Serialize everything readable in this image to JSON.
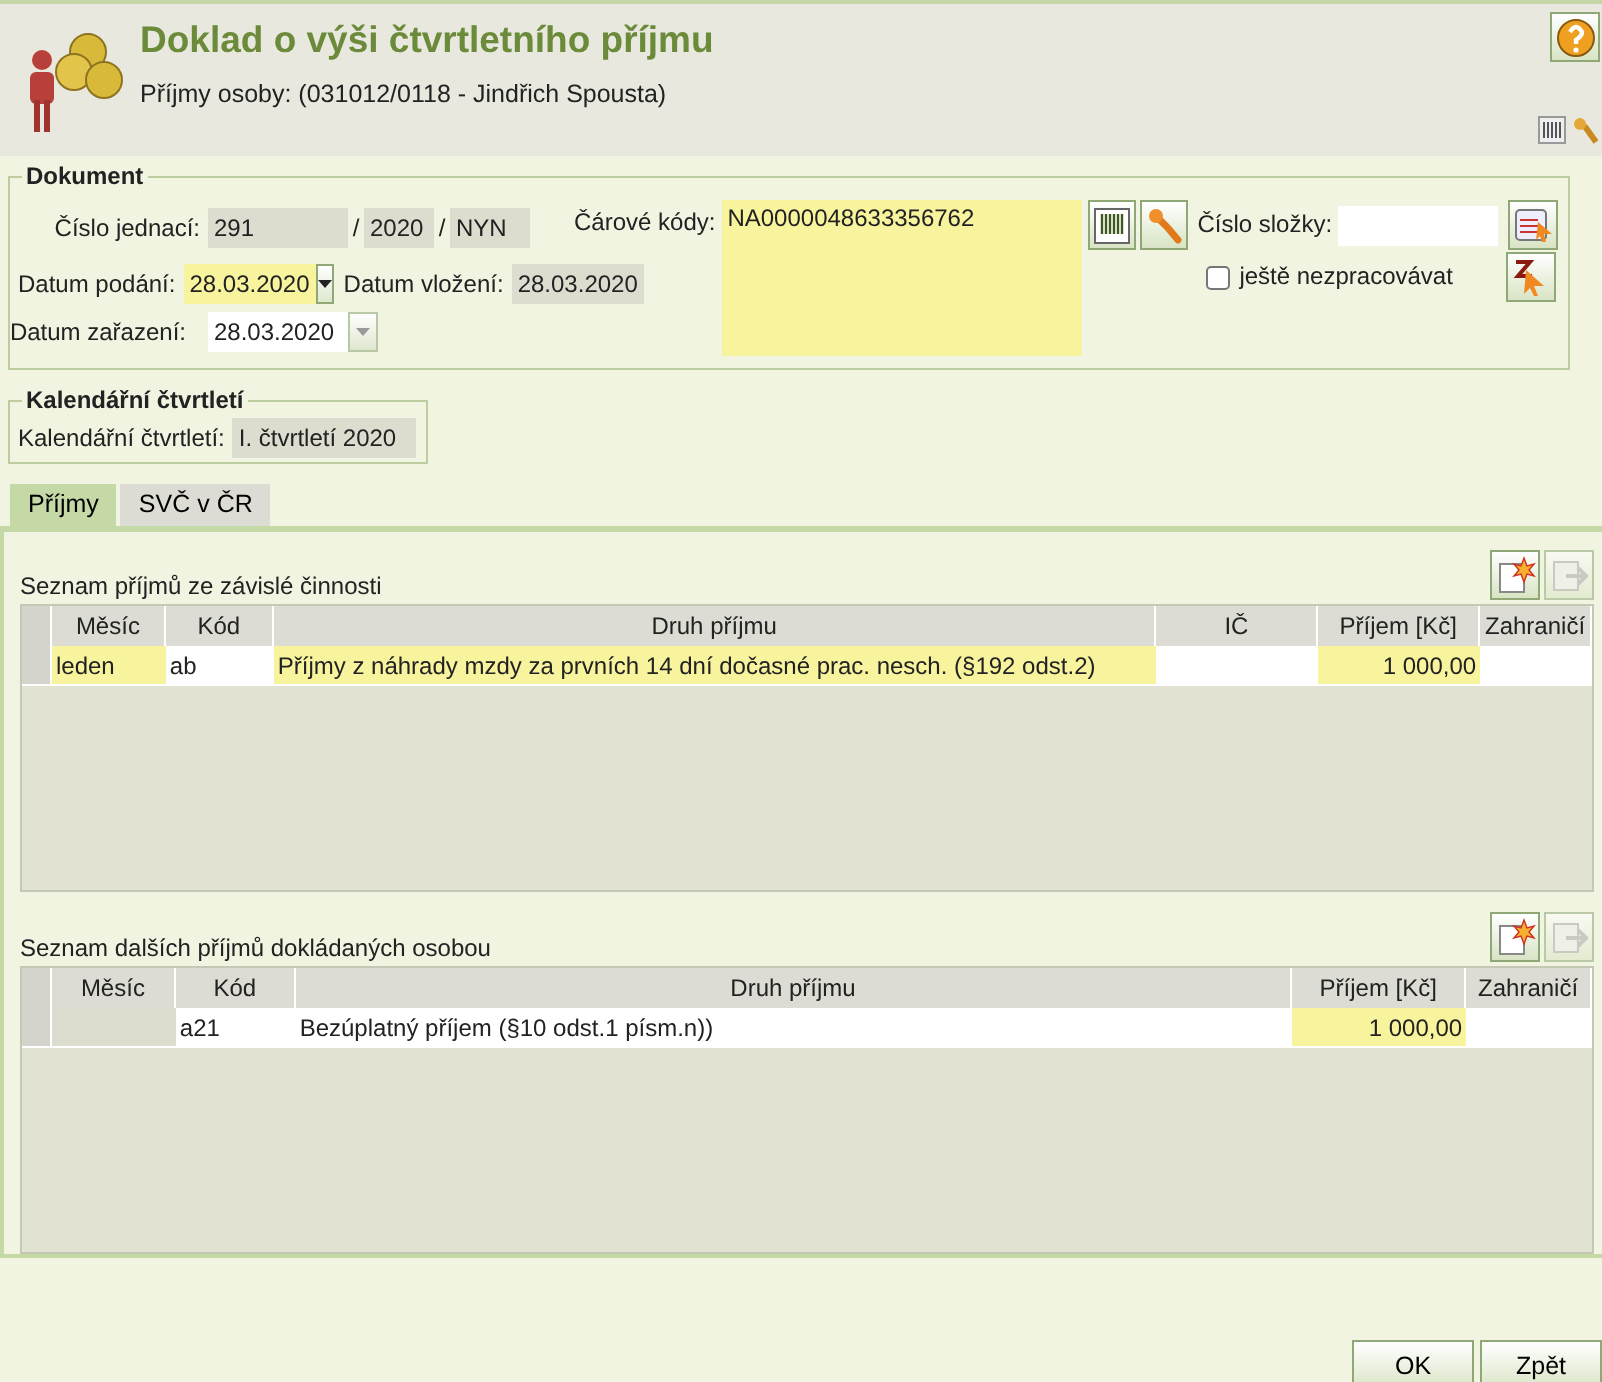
{
  "header": {
    "title": "Doklad o výši čtvrtletního příjmu",
    "subtitle": "Příjmy osoby: (031012/0118 - Jindřich Spousta)"
  },
  "dokument": {
    "legend": "Dokument",
    "cislo_jednaci": {
      "label": "Číslo jednací:",
      "parts": [
        {
          "value": "291",
          "kind": "readonly"
        },
        {
          "value": "2020",
          "kind": "readonly"
        },
        {
          "value": "NYN",
          "kind": "readonly"
        }
      ],
      "separators": [
        "/",
        "/"
      ]
    },
    "datum_podani": {
      "label": "Datum podání:",
      "value": "28.03.2020",
      "kind": "required",
      "disabled": false
    },
    "datum_vlozeni": {
      "label": "Datum vložení:",
      "value": "28.03.2020",
      "kind": "readonly"
    },
    "datum_zarazeni": {
      "label": "Datum zařazení:",
      "value": "28.03.2020",
      "kind": "editable",
      "disabled": true
    },
    "carove_kody": {
      "label": "Čárové kódy:",
      "value": "NA0000048633356762",
      "kind": "required"
    },
    "cislo_slozky": {
      "label": "Číslo složky:",
      "kind": "editable"
    },
    "nezpracovavat": {
      "label": "ještě nezpracovávat",
      "checked": false
    }
  },
  "kalendarni": {
    "legend": "Kalendářní čtvrtletí",
    "label": "Kalendářní čtvrtletí:",
    "value": "I. čtvrtletí 2020",
    "kind": "readonly"
  },
  "tabs": [
    {
      "label": "Příjmy",
      "selected": true
    },
    {
      "label": "SVČ v ČR",
      "selected": false
    }
  ],
  "grids": [
    {
      "title": "Seznam příjmů ze závislé činnosti",
      "toolbar": [
        {
          "kind": "add",
          "disabled": false
        },
        {
          "kind": "remove",
          "disabled": true
        }
      ],
      "columns": [
        {
          "label": "Měsíc",
          "kind": "required"
        },
        {
          "label": "Kód",
          "kind": "editable"
        },
        {
          "label": "Druh příjmu",
          "kind": "required"
        },
        {
          "label": "IČ",
          "kind": "editable"
        },
        {
          "label": "Příjem [Kč]",
          "kind": "required",
          "numeric": true
        },
        {
          "label": "Zahraničí",
          "kind": "editable"
        }
      ],
      "rows": [
        {
          "cells": [
            "leden",
            "ab",
            "Příjmy z náhrady mzdy za prvních 14 dní dočasné prac. nesch. (§192 odst.2)",
            null,
            "1 000,00",
            null
          ]
        }
      ]
    },
    {
      "title": "Seznam dalších příjmů dokládaných osobou",
      "toolbar": [
        {
          "kind": "add",
          "disabled": false
        },
        {
          "kind": "remove",
          "disabled": true
        }
      ],
      "columns": [
        {
          "label": "Měsíc",
          "kind": "readonly"
        },
        {
          "label": "Kód",
          "kind": "editable"
        },
        {
          "label": "Druh příjmu",
          "kind": "editable"
        },
        {
          "label": "Příjem [Kč]",
          "kind": "required",
          "numeric": true
        },
        {
          "label": "Zahraničí",
          "kind": "editable"
        }
      ],
      "rows": [
        {
          "cells": [
            null,
            "a21",
            "Bezúplatný příjem (§10 odst.1 písm.n))",
            "1 000,00",
            null
          ]
        }
      ]
    }
  ],
  "buttons": [
    "OK",
    "Zpět"
  ]
}
